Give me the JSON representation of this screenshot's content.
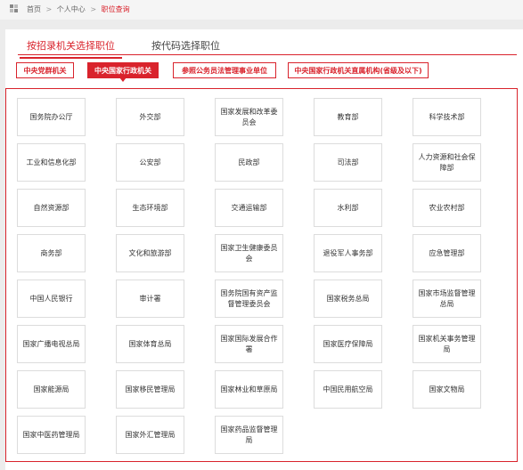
{
  "breadcrumb": {
    "home": "首页",
    "sep": ">",
    "level2": "个人中心",
    "current": "职位查询"
  },
  "tabs": [
    {
      "label": "按招录机关选择职位",
      "active": true
    },
    {
      "label": "按代码选择职位",
      "active": false
    }
  ],
  "categories": [
    {
      "label": "中央党群机关",
      "active": false
    },
    {
      "label": "中央国家行政机关",
      "active": true
    },
    {
      "label": "参照公务员法管理事业单位",
      "active": false
    },
    {
      "label": "中央国家行政机关直属机构(省级及以下)",
      "active": false
    }
  ],
  "departments": [
    "国务院办公厅",
    "外交部",
    "国家发展和改革委员会",
    "教育部",
    "科学技术部",
    "工业和信息化部",
    "公安部",
    "民政部",
    "司法部",
    "人力资源和社会保障部",
    "自然资源部",
    "生态环境部",
    "交通运输部",
    "水利部",
    "农业农村部",
    "商务部",
    "文化和旅游部",
    "国家卫生健康委员会",
    "退役军人事务部",
    "应急管理部",
    "中国人民银行",
    "审计署",
    "国务院国有资产监督管理委员会",
    "国家税务总局",
    "国家市场监督管理总局",
    "国家广播电视总局",
    "国家体育总局",
    "国家国际发展合作署",
    "国家医疗保障局",
    "国家机关事务管理局",
    "国家能源局",
    "国家移民管理局",
    "国家林业和草原局",
    "中国民用航空局",
    "国家文物局",
    "国家中医药管理局",
    "国家外汇管理局",
    "国家药品监督管理局"
  ],
  "colors": {
    "accent": "#d9232c",
    "border": "#dcdcdc",
    "background": "#ececec"
  }
}
